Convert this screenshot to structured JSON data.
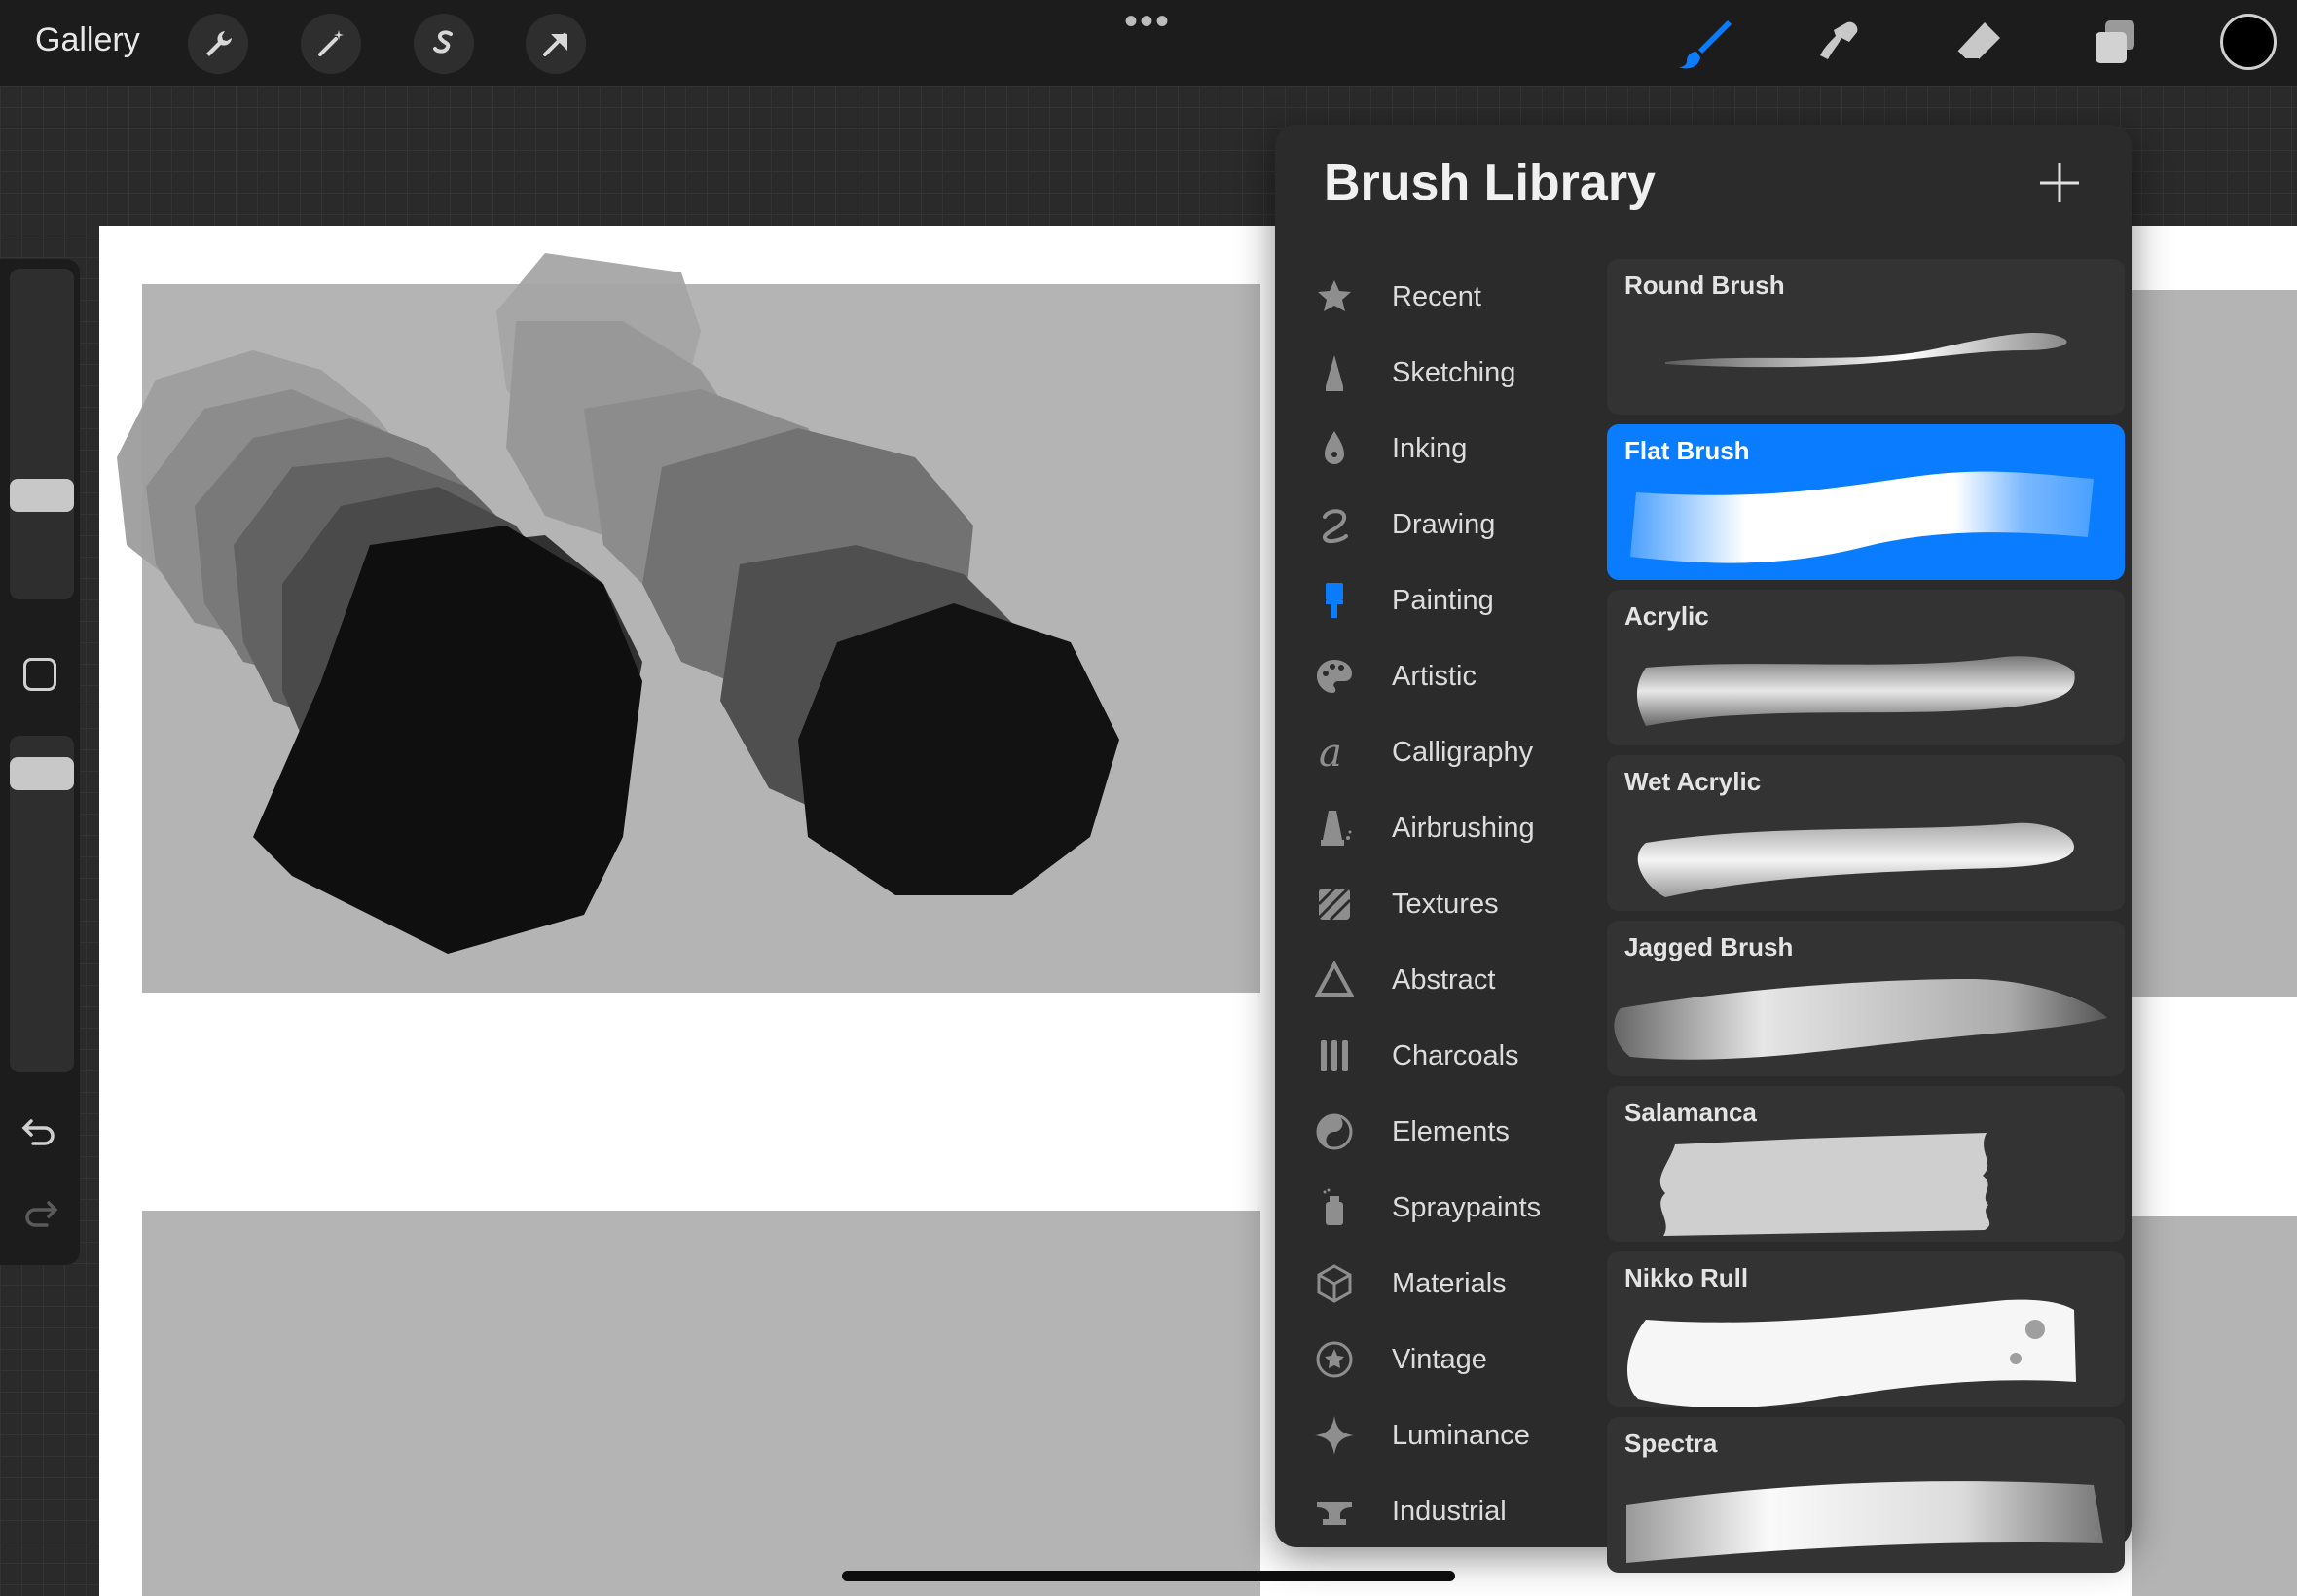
{
  "topbar": {
    "gallery_label": "Gallery",
    "more_label": "•••",
    "left_tools": [
      "wrench-icon",
      "magic-wand-icon",
      "selection-icon",
      "transform-arrow-icon"
    ],
    "right_tools": [
      "brush-icon",
      "smudge-icon",
      "eraser-icon",
      "layers-icon"
    ],
    "active_tool": "brush-icon",
    "current_color": "#000000",
    "accent_color": "#0a7cff"
  },
  "sidebar": {
    "tools": [
      "brush-size-slider",
      "modify-square-icon",
      "opacity-slider",
      "undo-icon",
      "redo-icon"
    ]
  },
  "library": {
    "title": "Brush Library",
    "add_label": "+",
    "categories": [
      {
        "label": "Recent",
        "icon": "star-icon"
      },
      {
        "label": "Sketching",
        "icon": "pencil-tip-icon"
      },
      {
        "label": "Inking",
        "icon": "pen-nib-icon"
      },
      {
        "label": "Drawing",
        "icon": "squiggle-icon"
      },
      {
        "label": "Painting",
        "icon": "paintbrush-icon"
      },
      {
        "label": "Artistic",
        "icon": "palette-icon"
      },
      {
        "label": "Calligraphy",
        "icon": "script-a-icon"
      },
      {
        "label": "Airbrushing",
        "icon": "airbrush-icon"
      },
      {
        "label": "Textures",
        "icon": "texture-icon"
      },
      {
        "label": "Abstract",
        "icon": "triangle-icon"
      },
      {
        "label": "Charcoals",
        "icon": "charcoal-sticks-icon"
      },
      {
        "label": "Elements",
        "icon": "yin-yang-icon"
      },
      {
        "label": "Spraypaints",
        "icon": "spray-can-icon"
      },
      {
        "label": "Materials",
        "icon": "cube-icon"
      },
      {
        "label": "Vintage",
        "icon": "star-badge-icon"
      },
      {
        "label": "Luminance",
        "icon": "sparkle-icon"
      },
      {
        "label": "Industrial",
        "icon": "anvil-icon"
      }
    ],
    "selected_category": "Painting",
    "brushes": [
      {
        "label": "Round Brush"
      },
      {
        "label": "Flat Brush"
      },
      {
        "label": "Acrylic"
      },
      {
        "label": "Wet Acrylic"
      },
      {
        "label": "Jagged Brush"
      },
      {
        "label": "Salamanca"
      },
      {
        "label": "Nikko Rull"
      },
      {
        "label": "Spectra"
      }
    ],
    "selected_brush": "Flat Brush"
  }
}
